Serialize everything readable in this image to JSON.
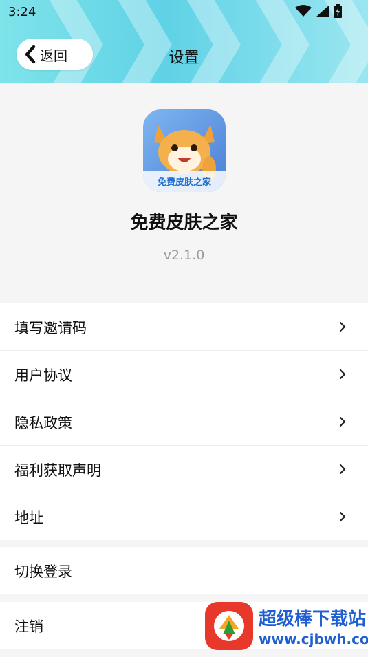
{
  "status_bar": {
    "time": "3:24"
  },
  "header": {
    "back_label": "返回",
    "title": "设置"
  },
  "app": {
    "name": "免费皮肤之家",
    "version": "v2.1.0",
    "icon_caption": "免费皮肤之家"
  },
  "menu": [
    {
      "label": "填写邀请码"
    },
    {
      "label": "用户协议"
    },
    {
      "label": "隐私政策"
    },
    {
      "label": "福利获取声明"
    },
    {
      "label": "地址"
    }
  ],
  "switch_login": {
    "label": "切换登录"
  },
  "logout": {
    "label": "注销"
  },
  "watermark": {
    "brand": "超级棒下载站",
    "url": "www.cjbwh.com"
  },
  "colors": {
    "header": "#5fd2e6",
    "background": "#f5f5f5",
    "version_text": "#9a9a9a"
  }
}
